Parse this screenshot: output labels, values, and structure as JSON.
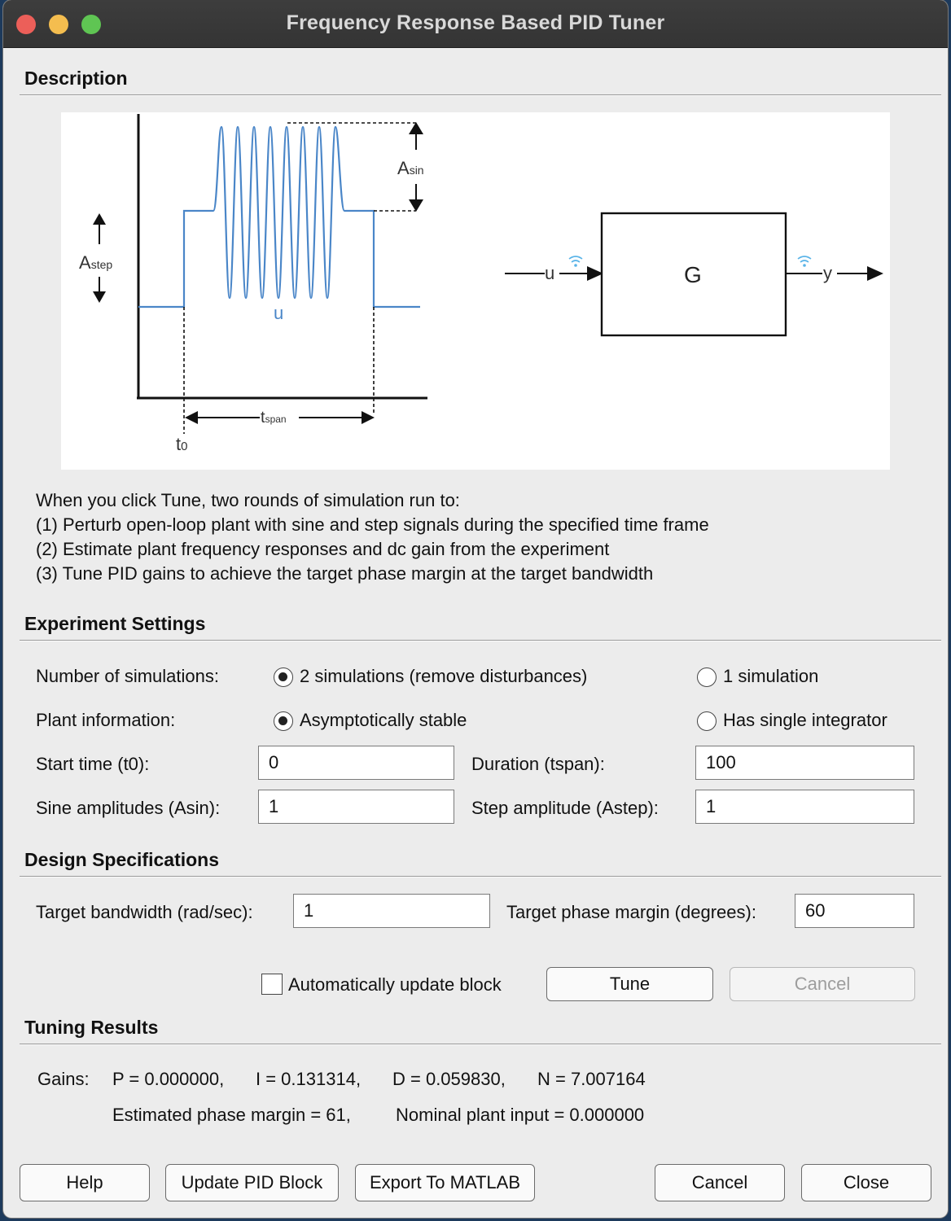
{
  "window": {
    "title": "Frequency Response Based PID Tuner"
  },
  "description": {
    "heading": "Description",
    "figure": {
      "a_sin": "A",
      "a_sin_sub": "sin",
      "a_step": "A",
      "a_step_sub": "step",
      "u_signal": "u",
      "t_span": "t",
      "t_span_sub": "span",
      "t_zero": "t",
      "t_zero_sub": "0",
      "block": "G",
      "input": "u",
      "output": "y"
    },
    "lines": [
      "When you click Tune, two rounds of simulation run to:",
      "(1) Perturb open-loop plant with sine and step signals during the specified time frame",
      "(2) Estimate plant frequency responses and dc gain from the experiment",
      "(3) Tune PID gains to achieve the target phase margin at the target bandwidth"
    ]
  },
  "experiment": {
    "heading": "Experiment Settings",
    "num_sims_label": "Number of simulations:",
    "num_sims_option1": "2 simulations (remove disturbances)",
    "num_sims_option2": "1 simulation",
    "plant_info_label": "Plant information:",
    "plant_option1": "Asymptotically stable",
    "plant_option2": "Has single integrator",
    "start_time_label": "Start time (t0):",
    "start_time_value": "0",
    "duration_label": "Duration (tspan):",
    "duration_value": "100",
    "sine_amp_label": "Sine amplitudes (Asin):",
    "sine_amp_value": "1",
    "step_amp_label": "Step amplitude (Astep):",
    "step_amp_value": "1"
  },
  "design": {
    "heading": "Design Specifications",
    "bandwidth_label": "Target bandwidth (rad/sec):",
    "bandwidth_value": "1",
    "phase_margin_label": "Target phase margin (degrees):",
    "phase_margin_value": "60",
    "auto_update_label": "Automatically update block",
    "tune_label": "Tune",
    "cancel_label": "Cancel"
  },
  "results": {
    "heading": "Tuning Results",
    "gains_label": "Gains:",
    "p": "P = 0.000000,",
    "i": "I = 0.131314,",
    "d": "D = 0.059830,",
    "n": "N = 7.007164",
    "est_phase_margin": "Estimated phase margin = 61,",
    "nominal_input": "Nominal plant input = 0.000000"
  },
  "footer": {
    "help": "Help",
    "update_pid": "Update PID Block",
    "export": "Export To MATLAB",
    "cancel": "Cancel",
    "close": "Close"
  },
  "colors": {
    "signal": "#4a86c8",
    "wifi": "#5ab4e8"
  }
}
